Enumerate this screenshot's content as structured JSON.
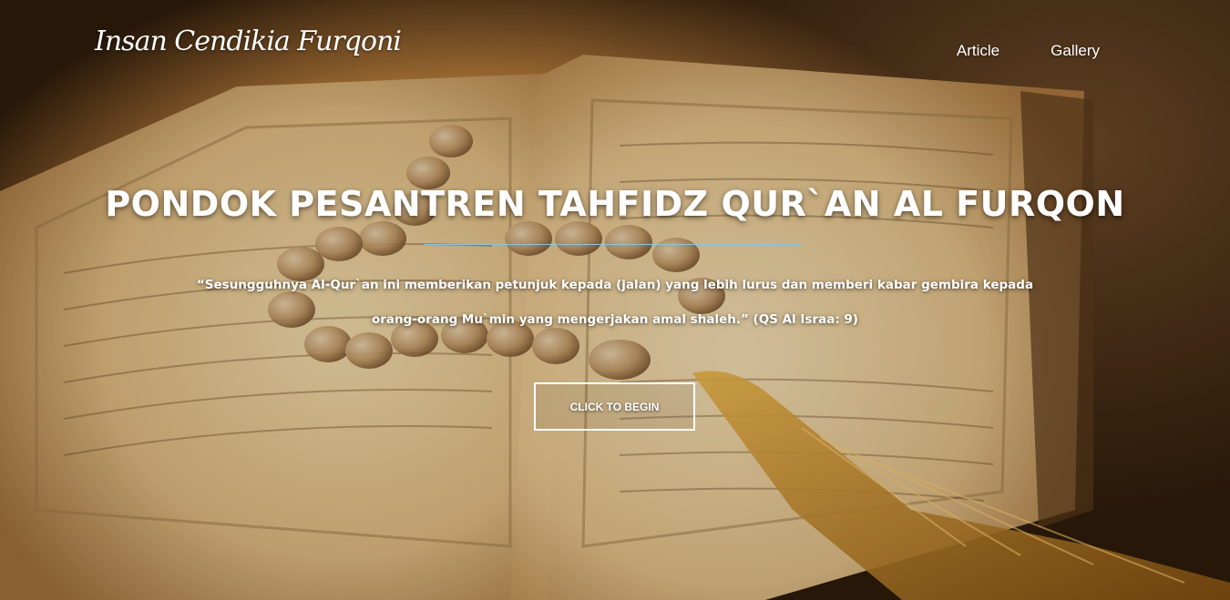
{
  "brand": {
    "name": "Insan Cendikia Furqoni"
  },
  "nav": {
    "items": [
      {
        "label": "Article"
      },
      {
        "label": "Gallery"
      }
    ]
  },
  "hero": {
    "title": "PONDOK PESANTREN TAHFIDZ QUR`AN AL FURQON",
    "quote": "“Sesungguhnya Al-Qur`an ini memberikan petunjuk kepada (jalan) yang lebih lurus dan memberi kabar gembira kepada orang-orang Mu`min yang mengerjakan amal shaleh.” (QS Al Israa: 9)",
    "cta_label": "CLICK TO BEGIN",
    "divider_color": "#8fc3d6"
  }
}
